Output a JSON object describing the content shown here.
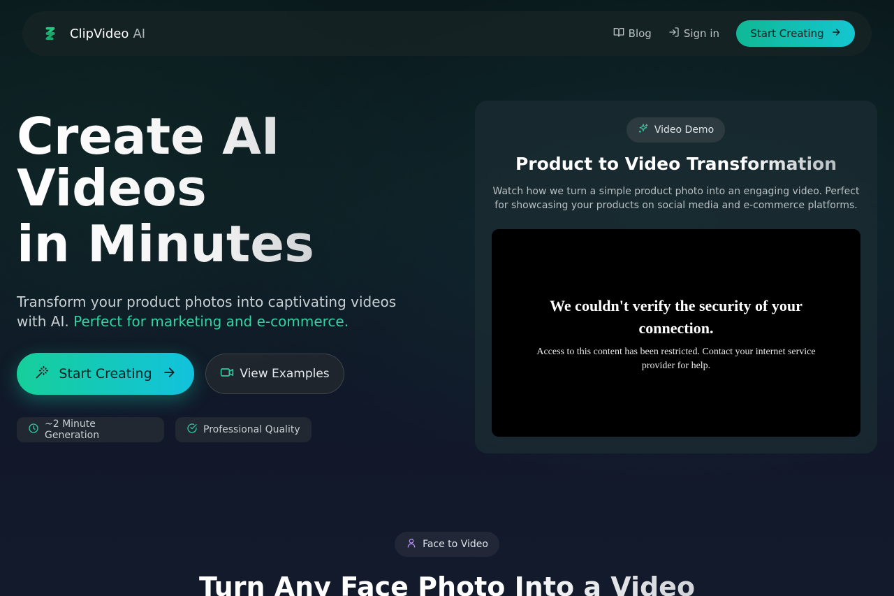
{
  "nav": {
    "brand_name": "ClipVideo",
    "brand_suffix": "AI",
    "blog_label": "Blog",
    "signin_label": "Sign in",
    "cta_label": "Start Creating"
  },
  "hero": {
    "title_line1": "Create AI",
    "title_line2": "Videos",
    "title_line3": "in Minutes",
    "subtitle_plain": "Transform your product photos into captivating videos with AI.",
    "subtitle_accent": "Perfect for marketing and e-commerce.",
    "primary_button": "Start Creating",
    "secondary_button": "View Examples",
    "features": [
      "~2 Minute Generation",
      "Professional Quality"
    ]
  },
  "demo": {
    "badge": "Video Demo",
    "title": "Product to Video Transformation",
    "description": "Watch how we turn a simple product photo into an engaging video. Perfect for showcasing your products on social media and e-commerce platforms.",
    "video_error_title": "We couldn't verify the security of your connection.",
    "video_error_message": "Access to this content has been restricted. Contact your internet service provider for help."
  },
  "face_section": {
    "badge": "Face to Video",
    "title": "Turn Any Face Photo Into a Video"
  },
  "colors": {
    "accent_green": "#34d3a4",
    "cta_gradient_start": "#10b895",
    "cta_gradient_end": "#14c6d0",
    "face_icon": "#b58cf5"
  },
  "icons": {
    "brand": "zigzag-logo-icon",
    "blog": "book-open-icon",
    "signin": "log-in-icon",
    "arrow": "arrow-right-icon",
    "wand": "magic-wand-icon",
    "video": "video-camera-icon",
    "clock": "clock-icon",
    "check": "check-circle-icon",
    "sparkles": "sparkles-icon",
    "user": "user-icon"
  }
}
